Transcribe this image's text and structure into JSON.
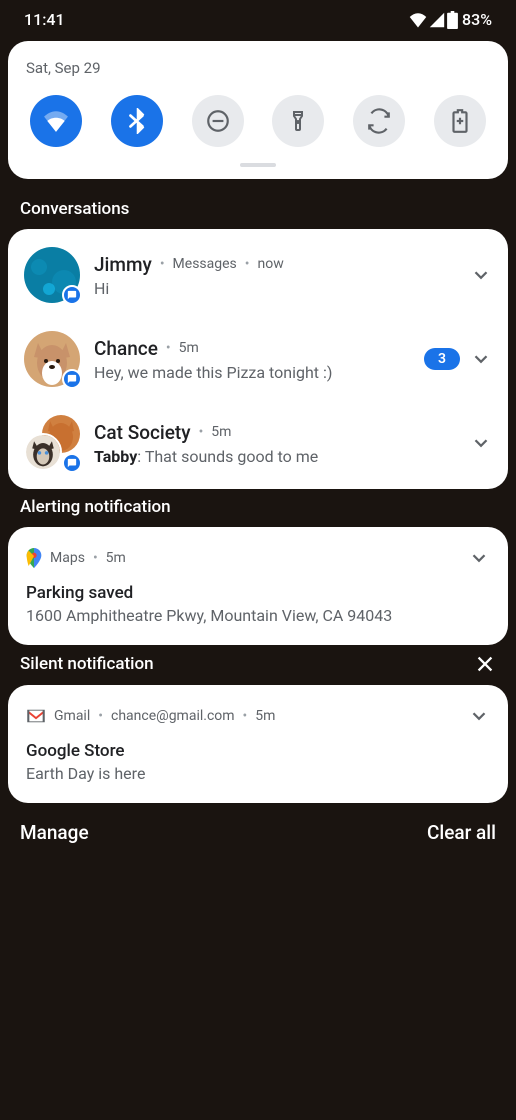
{
  "status": {
    "time": "11:41",
    "battery": "83%"
  },
  "qs": {
    "date": "Sat, Sep 29",
    "toggles": [
      {
        "name": "wifi",
        "active": true
      },
      {
        "name": "bluetooth",
        "active": true
      },
      {
        "name": "dnd",
        "active": false
      },
      {
        "name": "flashlight",
        "active": false
      },
      {
        "name": "autorotate",
        "active": false
      },
      {
        "name": "battery-saver",
        "active": false
      }
    ]
  },
  "sections": {
    "conversations": "Conversations",
    "alerting": "Alerting notification",
    "silent": "Silent notification"
  },
  "conversations": [
    {
      "title": "Jimmy",
      "app": "Messages",
      "when": "now",
      "body": "Hi",
      "count": 0
    },
    {
      "title": "Chance",
      "app": "",
      "when": "5m",
      "body": "Hey, we made this Pizza tonight :)",
      "count": 3
    },
    {
      "title": "Cat Society",
      "app": "",
      "when": "5m",
      "sender": "Tabby",
      "body": "That sounds good to me",
      "count": 0
    }
  ],
  "alerting": {
    "app": "Maps",
    "when": "5m",
    "title": "Parking saved",
    "body": "1600 Amphitheatre Pkwy, Mountain View, CA 94043"
  },
  "silent": {
    "app": "Gmail",
    "account": "chance@gmail.com",
    "when": "5m",
    "title": "Google Store",
    "body": "Earth Day is here"
  },
  "bottom": {
    "manage": "Manage",
    "clear": "Clear all"
  }
}
